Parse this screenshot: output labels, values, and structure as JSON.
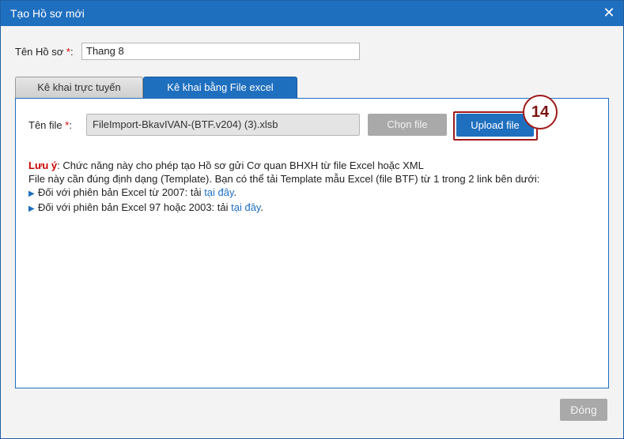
{
  "dialog": {
    "title": "Tạo Hồ sơ mới",
    "close_glyph": "✕"
  },
  "name_field": {
    "label": "Tên Hồ sơ ",
    "required_mark": "*",
    "label_suffix": ":",
    "value": "Thang 8"
  },
  "tabs": [
    {
      "label": "Kê khai trực tuyến",
      "active": false
    },
    {
      "label": "Kê khai bằng File excel",
      "active": true
    }
  ],
  "file_row": {
    "label": "Tên file ",
    "required_mark": "*",
    "label_suffix": ":",
    "value": "FileImport-BkavIVAN-(BTF.v204) (3).xlsb",
    "choose_label": "Chọn file",
    "upload_label": "Upload file",
    "step_number": "14"
  },
  "notes": {
    "title": "Lưu ý",
    "line1_rest": ": Chức năng này cho phép tạo Hồ sơ gửi Cơ quan BHXH từ file Excel hoặc XML",
    "line2": "File này cần đúng định dạng (Template). Bạn có thể tải Template mẫu Excel (file BTF) từ 1 trong 2 link bên dưới:",
    "bullet1_text": "Đối với phiên bản Excel từ 2007: tải ",
    "bullet1_link": "tại đây",
    "bullet2_text": "Đối với phiên bản Excel 97 hoặc 2003: tải ",
    "bullet2_link": "tại đây",
    "period": ".",
    "bullet_icon": "triangle-right-icon"
  },
  "footer": {
    "close_label": "Đóng"
  },
  "colors": {
    "primary": "#1f6fbf",
    "highlight": "#a01a1a",
    "disabled": "#a9a9a9",
    "warning_text": "#cc0000"
  }
}
